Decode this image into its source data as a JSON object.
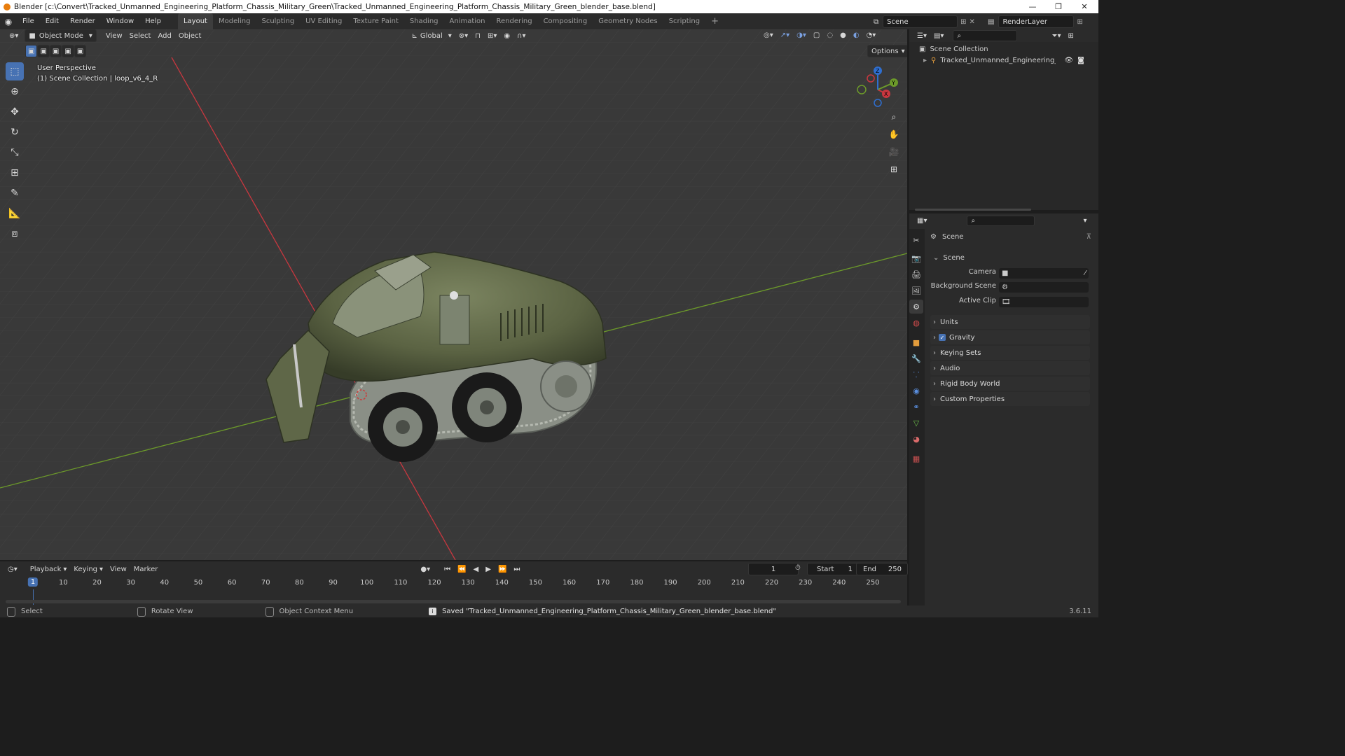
{
  "window": {
    "title": "Blender [c:\\Convert\\Tracked_Unmanned_Engineering_Platform_Chassis_Military_Green\\Tracked_Unmanned_Engineering_Platform_Chassis_Military_Green_blender_base.blend]",
    "minimize": "—",
    "maximize": "❐",
    "close": "✕"
  },
  "menu": [
    "File",
    "Edit",
    "Render",
    "Window",
    "Help"
  ],
  "workspaces": [
    "Layout",
    "Modeling",
    "Sculpting",
    "UV Editing",
    "Texture Paint",
    "Shading",
    "Animation",
    "Rendering",
    "Compositing",
    "Geometry Nodes",
    "Scripting"
  ],
  "active_workspace": "Layout",
  "scene_field": "Scene",
  "renderlayer_field": "RenderLayer",
  "viewport": {
    "mode": "Object Mode",
    "menus": [
      "View",
      "Select",
      "Add",
      "Object"
    ],
    "transform_orientation": "Global",
    "options_label": "Options",
    "overlay_line1": "User Perspective",
    "overlay_line2": "(1) Scene Collection | loop_v6_4_R",
    "gizmo": {
      "x": "X",
      "y": "Y",
      "z": "Z"
    }
  },
  "outliner": {
    "root": "Scene Collection",
    "items": [
      {
        "name": "Tracked_Unmanned_Engineering_Platfor"
      }
    ]
  },
  "properties": {
    "context": "Scene",
    "panel_title": "Scene",
    "fields": [
      {
        "label": "Camera"
      },
      {
        "label": "Background Scene"
      },
      {
        "label": "Active Clip"
      }
    ],
    "subpanels": [
      "Units",
      "Gravity",
      "Keying Sets",
      "Audio",
      "Rigid Body World",
      "Custom Properties"
    ],
    "gravity_checked": true
  },
  "timeline": {
    "menus": [
      "Playback",
      "Keying",
      "View",
      "Marker"
    ],
    "current_frame": "1",
    "start_label": "Start",
    "start": "1",
    "end_label": "End",
    "end": "250",
    "ticks": [
      "1",
      "10",
      "20",
      "30",
      "40",
      "50",
      "60",
      "70",
      "80",
      "90",
      "100",
      "110",
      "120",
      "130",
      "140",
      "150",
      "160",
      "170",
      "180",
      "190",
      "200",
      "210",
      "220",
      "230",
      "240",
      "250"
    ]
  },
  "statusbar": {
    "select": "Select",
    "rotate": "Rotate View",
    "context_menu": "Object Context Menu",
    "message": "Saved \"Tracked_Unmanned_Engineering_Platform_Chassis_Military_Green_blender_base.blend\"",
    "version": "3.6.11"
  },
  "colors": {
    "accent": "#4772b3",
    "vehicle": "#5b6343",
    "x_axis": "#c9373f",
    "y_axis": "#6c9a2a"
  }
}
